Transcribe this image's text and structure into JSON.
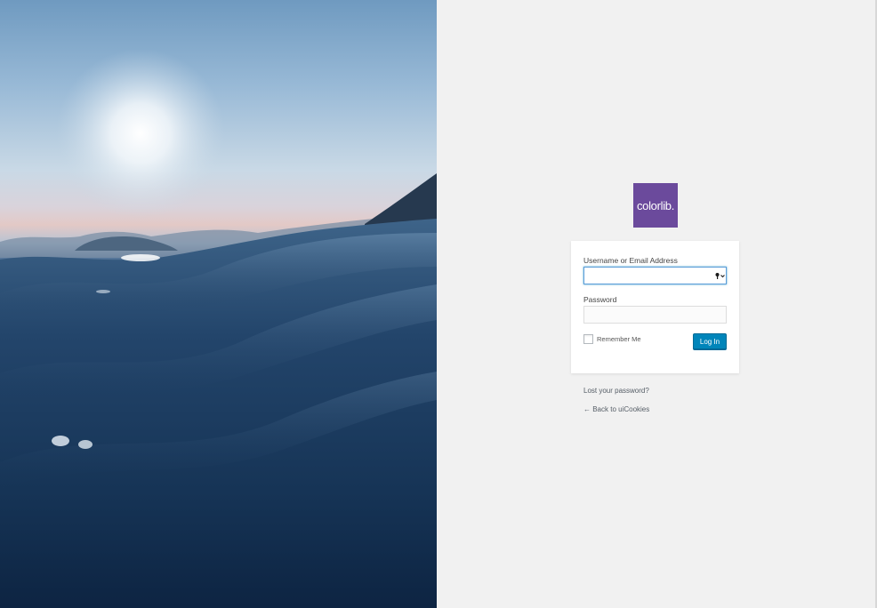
{
  "brand": {
    "logo_text": "colorlib.",
    "logo_color": "#6b4a9c"
  },
  "form": {
    "username_label": "Username or Email Address",
    "username_value": "",
    "password_label": "Password",
    "password_value": "",
    "remember_label": "Remember Me",
    "remember_checked": false,
    "submit_label": "Log In",
    "submit_color": "#0085ba",
    "input_icon": "key-icon"
  },
  "links": {
    "lost_password": "Lost your password?",
    "back_to_site": "← Back to uiCookies"
  },
  "hero": {
    "description_icon": "ocean-photo"
  }
}
